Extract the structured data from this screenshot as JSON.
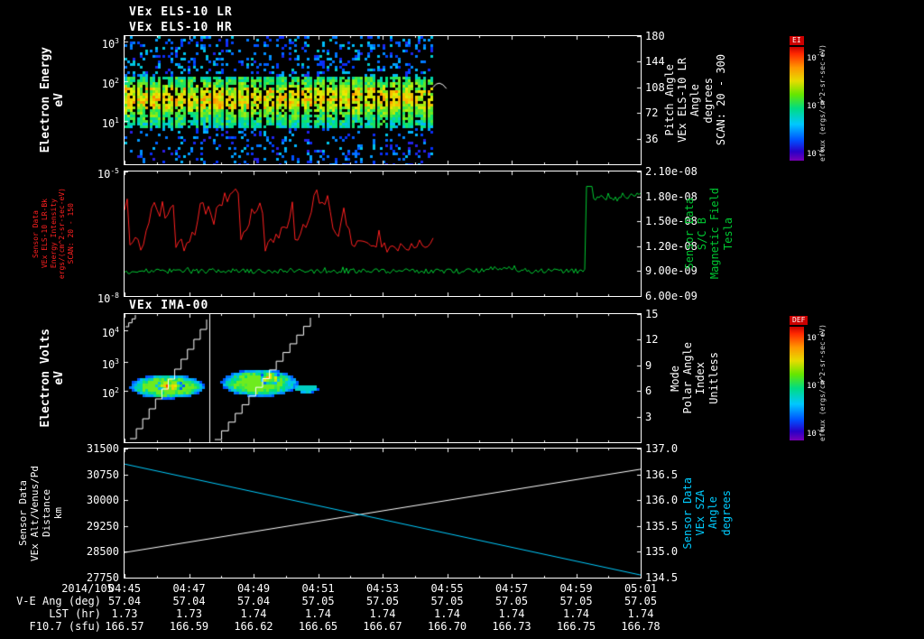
{
  "titles": {
    "panel1_line1": "VEx ELS-10 LR",
    "panel1_line2": "VEx ELS-10 HR",
    "panel3": "VEx IMA-00"
  },
  "colors": {
    "background": "#000000",
    "foreground": "#ffffff",
    "red_series": "#ff2020",
    "green_series": "#00c832",
    "cyan_series": "#00ccff",
    "colorbar_badge": "#cc0000"
  },
  "xaxis": {
    "date": "2014/105",
    "ticks": [
      "04:45",
      "04:47",
      "04:49",
      "04:51",
      "04:53",
      "04:55",
      "04:57",
      "04:59",
      "05:01"
    ]
  },
  "rows": [
    {
      "label": "V-E Ang (deg)",
      "values": [
        "57.04",
        "57.04",
        "57.04",
        "57.05",
        "57.05",
        "57.05",
        "57.05",
        "57.05",
        "57.05"
      ]
    },
    {
      "label": "LST (hr)",
      "values": [
        "1.73",
        "1.73",
        "1.74",
        "1.74",
        "1.74",
        "1.74",
        "1.74",
        "1.74",
        "1.74"
      ]
    },
    {
      "label": "F10.7 (sfu)",
      "values": [
        "166.57",
        "166.59",
        "166.62",
        "166.65",
        "166.67",
        "166.70",
        "166.73",
        "166.75",
        "166.78"
      ]
    }
  ],
  "chart_data": [
    {
      "type": "heatmap",
      "title": "VEx ELS-10 LR / VEx ELS-10 HR",
      "ylabel_lines": [
        "Electron Energy",
        "eV"
      ],
      "yscale": "log",
      "yticks": [
        "10^3",
        "10^2",
        "10^1"
      ],
      "xlim": [
        "04:45",
        "05:01"
      ],
      "data_end_frac": 0.594,
      "data_coverage": "04:45 to ~04:55",
      "right_axis": {
        "title_lines": [
          "Pitch Angle",
          "VEx ELS-10 LR",
          "Angle",
          "degrees",
          "SCAN: 20 - 300"
        ],
        "ticks": [
          "180",
          "144",
          "108",
          "72",
          "36"
        ],
        "range": [
          0,
          180
        ]
      },
      "colorbar": {
        "title": "EI",
        "ticks": [
          "10^-4",
          "10^-6",
          "10^-8"
        ],
        "units": "eflux (ergs/cm^2-sr-sec-eV)"
      },
      "description": "Electron energy-time spectrogram: dense cyan/green/yellow flux band between roughly 20 and 300 eV with sparse blue/cyan points at other energies; measurements stop near 04:55."
    },
    {
      "type": "line",
      "left_axis": {
        "title_lines": [
          "Sensor Data",
          "VEx ELS-10 LR-Bk",
          "Energy Intensity",
          "ergs/(cm^2-sr-sec-eV)",
          "SCAN: 20 - 150"
        ],
        "ticks": [
          "10^-5",
          "10^-8"
        ],
        "scale": "log"
      },
      "right_axis": {
        "title_lines": [
          "Sensor Data",
          "S/C B",
          "Magnetic Field",
          "Tesla"
        ],
        "ticks": [
          "2.10e-08",
          "1.80e-08",
          "1.50e-08",
          "1.20e-08",
          "9.00e-09",
          "6.00e-09"
        ]
      },
      "green_baseline": 9e-09,
      "green_step_value": 1.8e-08,
      "green_step_time_frac": 0.895,
      "red_data_end_frac": 0.6,
      "series": [
        {
          "name": "VEx ELS-10 LR-Bk energy intensity",
          "color": "#ff2020",
          "axis": "left",
          "behavior": "noisy oscillation between ~1e-07 and ~5e-06 ergs/(cm^2-sr-sec-eV); data ends near 04:55"
        },
        {
          "name": "S/C B magnetic field",
          "color": "#00c832",
          "axis": "right",
          "behavior": "~9.0e-09 T with small fluctuations, steps up to ~1.8e-08 T near 05:00"
        }
      ]
    },
    {
      "type": "heatmap",
      "title": "VEx IMA-00",
      "ylabel_lines": [
        "Electron Volts",
        "eV"
      ],
      "yscale": "log",
      "yticks": [
        "10^4",
        "10^3",
        "10^2"
      ],
      "right_axis": {
        "title_lines": [
          "Mode",
          "Polar Angle",
          "Index",
          "Unitless"
        ],
        "ticks": [
          "15",
          "12",
          "9",
          "6",
          "3"
        ]
      },
      "colorbar": {
        "title": "DEF",
        "ticks": [
          "10^-4",
          "10^-6",
          "10^-8"
        ],
        "units": "eflux (ergs/cm^2-sr-sec-eV)"
      },
      "description": "Ion energy-time spectrogram: two flux bursts near a few hundred eV between ~04:45 and ~04:50 with red/orange cores and blue-green edges; white stepped scan-angle lines and a vertical divider overlay."
    },
    {
      "type": "line",
      "left_axis": {
        "title_lines": [
          "Sensor Data",
          "VEx Alt/Venus/Pd",
          "Distance",
          "km"
        ],
        "ticks": [
          "31500",
          "30750",
          "30000",
          "29250",
          "28500",
          "27750"
        ]
      },
      "right_axis": {
        "title_lines": [
          "Sensor Data",
          "VEx SZA",
          "Angle",
          "degrees"
        ],
        "ticks": [
          "137.0",
          "136.5",
          "136.0",
          "135.5",
          "135.0",
          "134.5"
        ]
      },
      "series": [
        {
          "name": "VEx altitude / Venus Pd distance",
          "color": "#ffffff",
          "axis": "left",
          "x": [
            "04:45",
            "05:01"
          ],
          "values": [
            28480,
            30900
          ]
        },
        {
          "name": "VEx solar zenith angle",
          "color": "#00ccff",
          "axis": "right",
          "x": [
            "04:45",
            "05:01"
          ],
          "values": [
            136.7,
            134.55
          ]
        }
      ]
    }
  ]
}
